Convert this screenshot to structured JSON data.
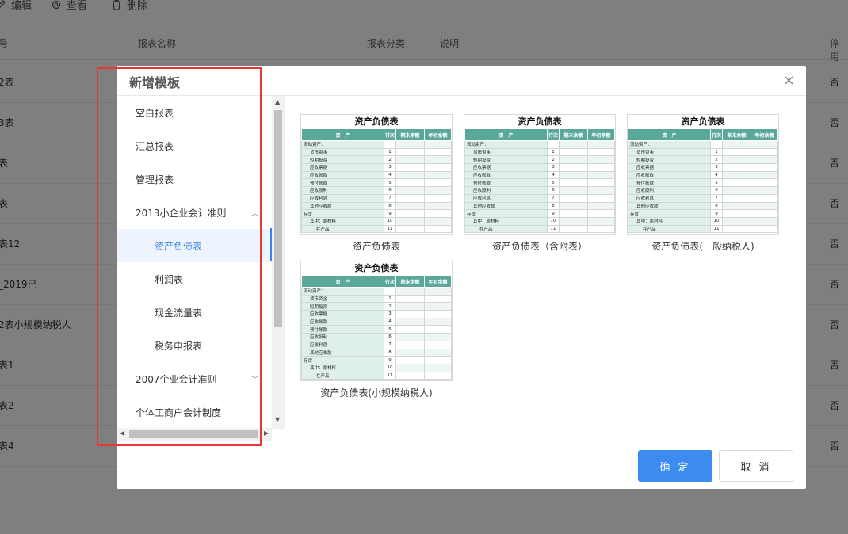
{
  "background": {
    "toolbar": [
      {
        "icon": "edit-icon",
        "label": "编辑"
      },
      {
        "icon": "gear-icon",
        "label": "查看"
      },
      {
        "icon": "trash-icon",
        "label": "删除"
      }
    ],
    "headers": {
      "col0": "号",
      "name": "报表名称",
      "category": "报表分类",
      "desc": "说明",
      "disabled": "停用"
    },
    "rows": [
      {
        "name": "2表",
        "disabled": "否"
      },
      {
        "name": "3表",
        "disabled": "否"
      },
      {
        "name": "表",
        "disabled": "否"
      },
      {
        "name": "表",
        "disabled": "否"
      },
      {
        "name": "表12",
        "disabled": "否"
      },
      {
        "name": "_2019已",
        "disabled": "否"
      },
      {
        "name": "2表小规模纳税人",
        "disabled": "否"
      },
      {
        "name": "表1",
        "disabled": "否"
      },
      {
        "name": "表2",
        "disabled": "否"
      },
      {
        "name": "表4",
        "disabled": "否"
      }
    ]
  },
  "dialog": {
    "title": "新增模板",
    "close": "×",
    "tree": [
      {
        "label": "空白报表",
        "level": 0
      },
      {
        "label": "汇总报表",
        "level": 0
      },
      {
        "label": "管理报表",
        "level": 0
      },
      {
        "label": "2013小企业会计准则",
        "level": 0,
        "arrow": "︿"
      },
      {
        "label": "资产负债表",
        "level": 1,
        "active": true
      },
      {
        "label": "利润表",
        "level": 1
      },
      {
        "label": "现金流量表",
        "level": 1
      },
      {
        "label": "税务申报表",
        "level": 1
      },
      {
        "label": "2007企业会计准则",
        "level": 0,
        "arrow": "﹀"
      },
      {
        "label": "个体工商户会计制度",
        "level": 0
      }
    ],
    "thumb": {
      "title": "资产负债表",
      "headers": [
        "资　产",
        "行次",
        "期末余额",
        "年初余额"
      ],
      "rows": [
        {
          "label": "流动资产：",
          "no": ""
        },
        {
          "label": "货币资金",
          "no": "1"
        },
        {
          "label": "短期投资",
          "no": "2"
        },
        {
          "label": "应收票据",
          "no": "3"
        },
        {
          "label": "应收账款",
          "no": "4"
        },
        {
          "label": "预付账款",
          "no": "5"
        },
        {
          "label": "应收股利",
          "no": "6"
        },
        {
          "label": "应收利息",
          "no": "7"
        },
        {
          "label": "其他应收款",
          "no": "8"
        },
        {
          "label": "存货",
          "no": "9"
        },
        {
          "label": "其中：原材料",
          "no": "10"
        },
        {
          "label": "在产品",
          "no": "11"
        }
      ]
    },
    "templates": [
      {
        "name": "资产负债表"
      },
      {
        "name": "资产负债表（含附表）"
      },
      {
        "name": "资产负债表(一般纳税人)"
      },
      {
        "name": "资产负债表(小规模纳税人)"
      }
    ],
    "buttons": {
      "ok": "确 定",
      "cancel": "取 消"
    }
  },
  "colors": {
    "accent": "#3c8cf0",
    "table_header": "#5aa89a",
    "highlight_box": "#e53935"
  }
}
